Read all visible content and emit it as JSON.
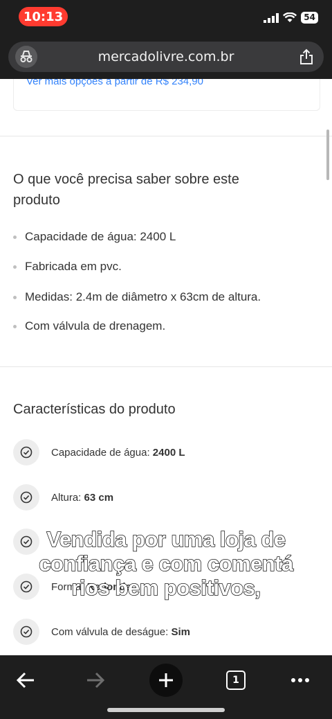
{
  "status_bar": {
    "time": "10:13",
    "battery": "54"
  },
  "browser": {
    "url": "mercadolivre.com.br",
    "tab_count": "1"
  },
  "offers": {
    "more_options_link": "Ver mais opções a partir de R$ 234,90"
  },
  "know_section": {
    "title_line1": "O que você precisa saber sobre este",
    "title_line2": "produto",
    "bullets": [
      "Capacidade de água: 2400 L",
      "Fabricada em pvc.",
      "Medidas: 2.4m de diâmetro x 63cm de altura.",
      "Com válvula de drenagem."
    ]
  },
  "characteristics": {
    "title": "Características do produto",
    "items": [
      {
        "label": "Capacidade de água:",
        "value": "2400 L"
      },
      {
        "label": "Altura:",
        "value": "63 cm"
      },
      {
        "label": "",
        "value": ""
      },
      {
        "label": "Forma:",
        "value": "Redonda"
      },
      {
        "label": "Com válvula de deságue:",
        "value": "Sim"
      }
    ]
  },
  "caption": {
    "line1": "Vendida por uma loja de",
    "line2": "confiança e com comentá",
    "line3": "rios bem positivos,"
  },
  "colors": {
    "link_blue": "#3483fa",
    "caption_text": "#ffffff",
    "recording_pill": "#ff3b30"
  }
}
